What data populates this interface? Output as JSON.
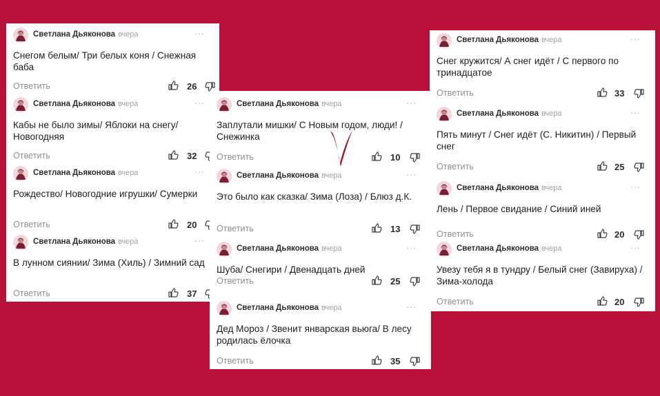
{
  "colors": {
    "background": "#b8123b",
    "panel": "#ffffff",
    "checkmark": "#a5122b"
  },
  "icons": {
    "like": "thumbs-up-icon",
    "dislike": "thumbs-down-icon",
    "more": "more-dots-icon",
    "avatar": "avatar-icon"
  },
  "author": "Светлана Дьяконова",
  "time": "вчера",
  "more_glyph": "···",
  "reply_label": "Ответить",
  "columns": {
    "left": [
      {
        "text": "Снегом белым/ Три белых коня / Снежная баба",
        "likes": "26"
      },
      {
        "text": "Кабы не было зимы/ Яблоки на снегу/ Новогодняя",
        "likes": "32"
      },
      {
        "text": "Рождество/ Новогодние игрушки/ Сумерки",
        "likes": "20"
      },
      {
        "text": "В лунном сиянии/ Зима (Хиль) / Зимний сад",
        "likes": "37"
      }
    ],
    "middle": [
      {
        "text": "Заплутали мишки/ С Новым годом, люди! / Снежинка",
        "likes": "10"
      },
      {
        "text": "Это было как сказка/ Зима (Лоза)  / Блюз д.К.",
        "likes": "13"
      },
      {
        "text": "Шуба/ Снегири / Двенадцать дней",
        "likes": "25"
      },
      {
        "text": "Дед Мороз / Звенит январская вьюга/ В лесу родилась ёлочка",
        "likes": "35"
      }
    ],
    "right": [
      {
        "text": "Снег кружится/ А снег идёт / С первого по тринадцатое",
        "likes": "33"
      },
      {
        "text": "Пять минут / Снег идёт (С. Никитин) / Первый снег",
        "likes": "25"
      },
      {
        "text": "Лень / Первое свидание / Синий иней",
        "likes": "20"
      },
      {
        "text": "Увезу тебя я в тундру / Белый снег (Завируха) / Зима-холода",
        "likes": "20"
      }
    ]
  }
}
